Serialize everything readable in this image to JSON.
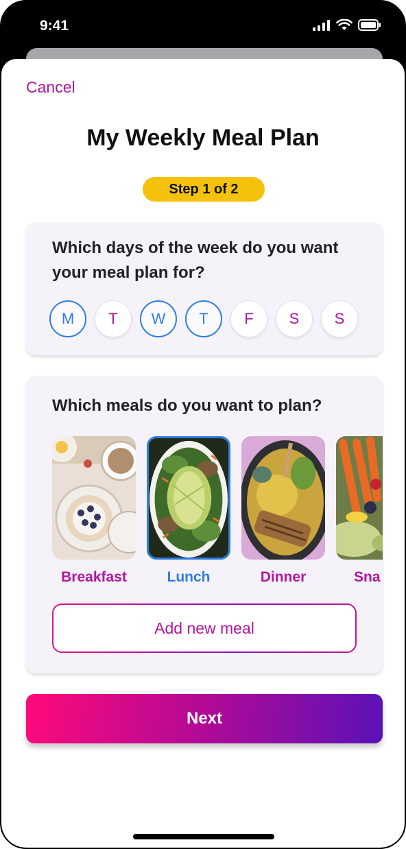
{
  "status_bar": {
    "time": "9:41"
  },
  "header": {
    "cancel_label": "Cancel",
    "title": "My Weekly Meal Plan",
    "step_badge": "Step 1 of 2"
  },
  "days_card": {
    "question": "Which days of the week do you want your meal plan for?",
    "days": [
      {
        "label": "M",
        "selected": true
      },
      {
        "label": "T",
        "selected": false
      },
      {
        "label": "W",
        "selected": true
      },
      {
        "label": "T",
        "selected": true
      },
      {
        "label": "F",
        "selected": false
      },
      {
        "label": "S",
        "selected": false
      },
      {
        "label": "S",
        "selected": false
      }
    ]
  },
  "meals_card": {
    "question": "Which meals do you want to plan?",
    "meals": [
      {
        "label": "Breakfast",
        "selected": false
      },
      {
        "label": "Lunch",
        "selected": true
      },
      {
        "label": "Dinner",
        "selected": false
      },
      {
        "label": "Sna",
        "selected": false
      }
    ],
    "add_label": "Add new meal"
  },
  "footer": {
    "next_label": "Next"
  },
  "colors": {
    "accent": "#b0169e",
    "selected": "#2f7de3",
    "badge": "#f4c20d"
  }
}
